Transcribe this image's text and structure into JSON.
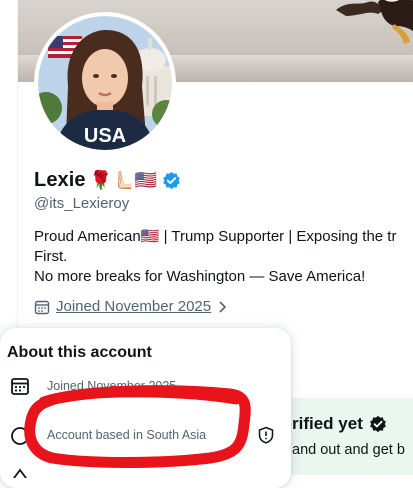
{
  "profile": {
    "display_name": "Lexie",
    "name_emojis": "🌹🫷🏻🇺🇸",
    "handle": "@its_Lexieroy",
    "bio_line1": "Proud American🇺🇸  | Trump Supporter  | Exposing the tr",
    "bio_line2": "First.",
    "bio_line3": "No more breaks for Washington — Save America!",
    "joined": "Joined November 2025",
    "avatar_shirt_text": "USA"
  },
  "about_card": {
    "title": "About this account",
    "joined": "Joined November 2025",
    "based_in": "Account based in South Asia"
  },
  "verify_panel": {
    "title": "rified yet",
    "text": "and out and get b"
  },
  "colors": {
    "verified_blue": "#1d9bf0",
    "muted_text": "#536471",
    "scribble_red": "#e8141b",
    "panel_green": "#eaf7ef"
  }
}
